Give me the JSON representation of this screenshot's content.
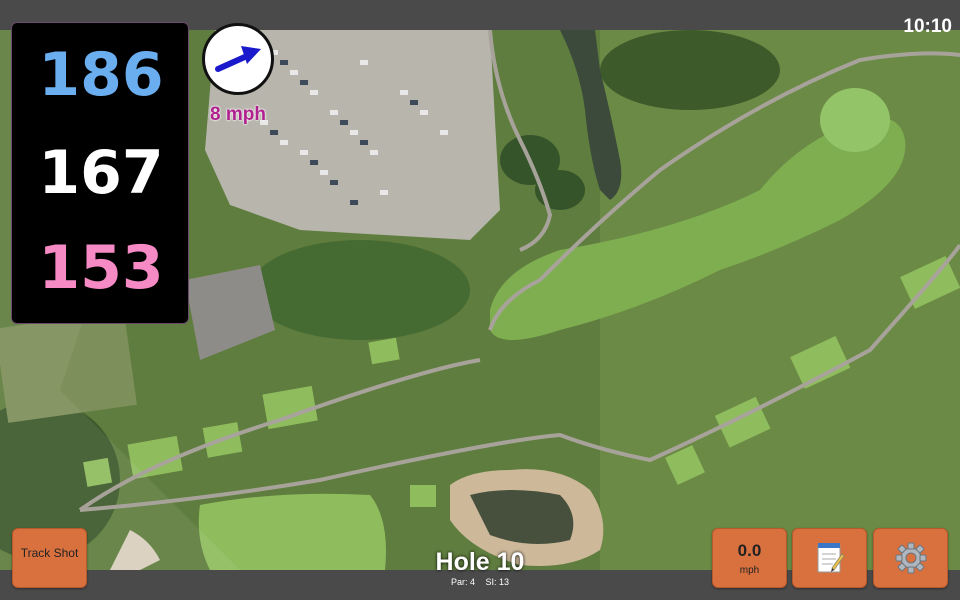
{
  "status": {
    "clock": "10:10"
  },
  "distances": {
    "back": "186",
    "middle": "167",
    "front": "153",
    "colors": {
      "back": "#6aaef0",
      "middle": "#ffffff",
      "front": "#f58ac4"
    }
  },
  "wind": {
    "speed_label": "8 mph",
    "icon": "wind-arrow-icon",
    "speed_color": "#b0208f"
  },
  "buttons": {
    "track_shot": "Track Shot",
    "speed_value": "0.0",
    "speed_unit": "mph",
    "notes_icon": "notepad-icon",
    "settings_icon": "gear-icon",
    "accent": "#d9713f"
  },
  "hole": {
    "title": "Hole 10",
    "par": "Par: 4",
    "si": "SI: 13"
  }
}
